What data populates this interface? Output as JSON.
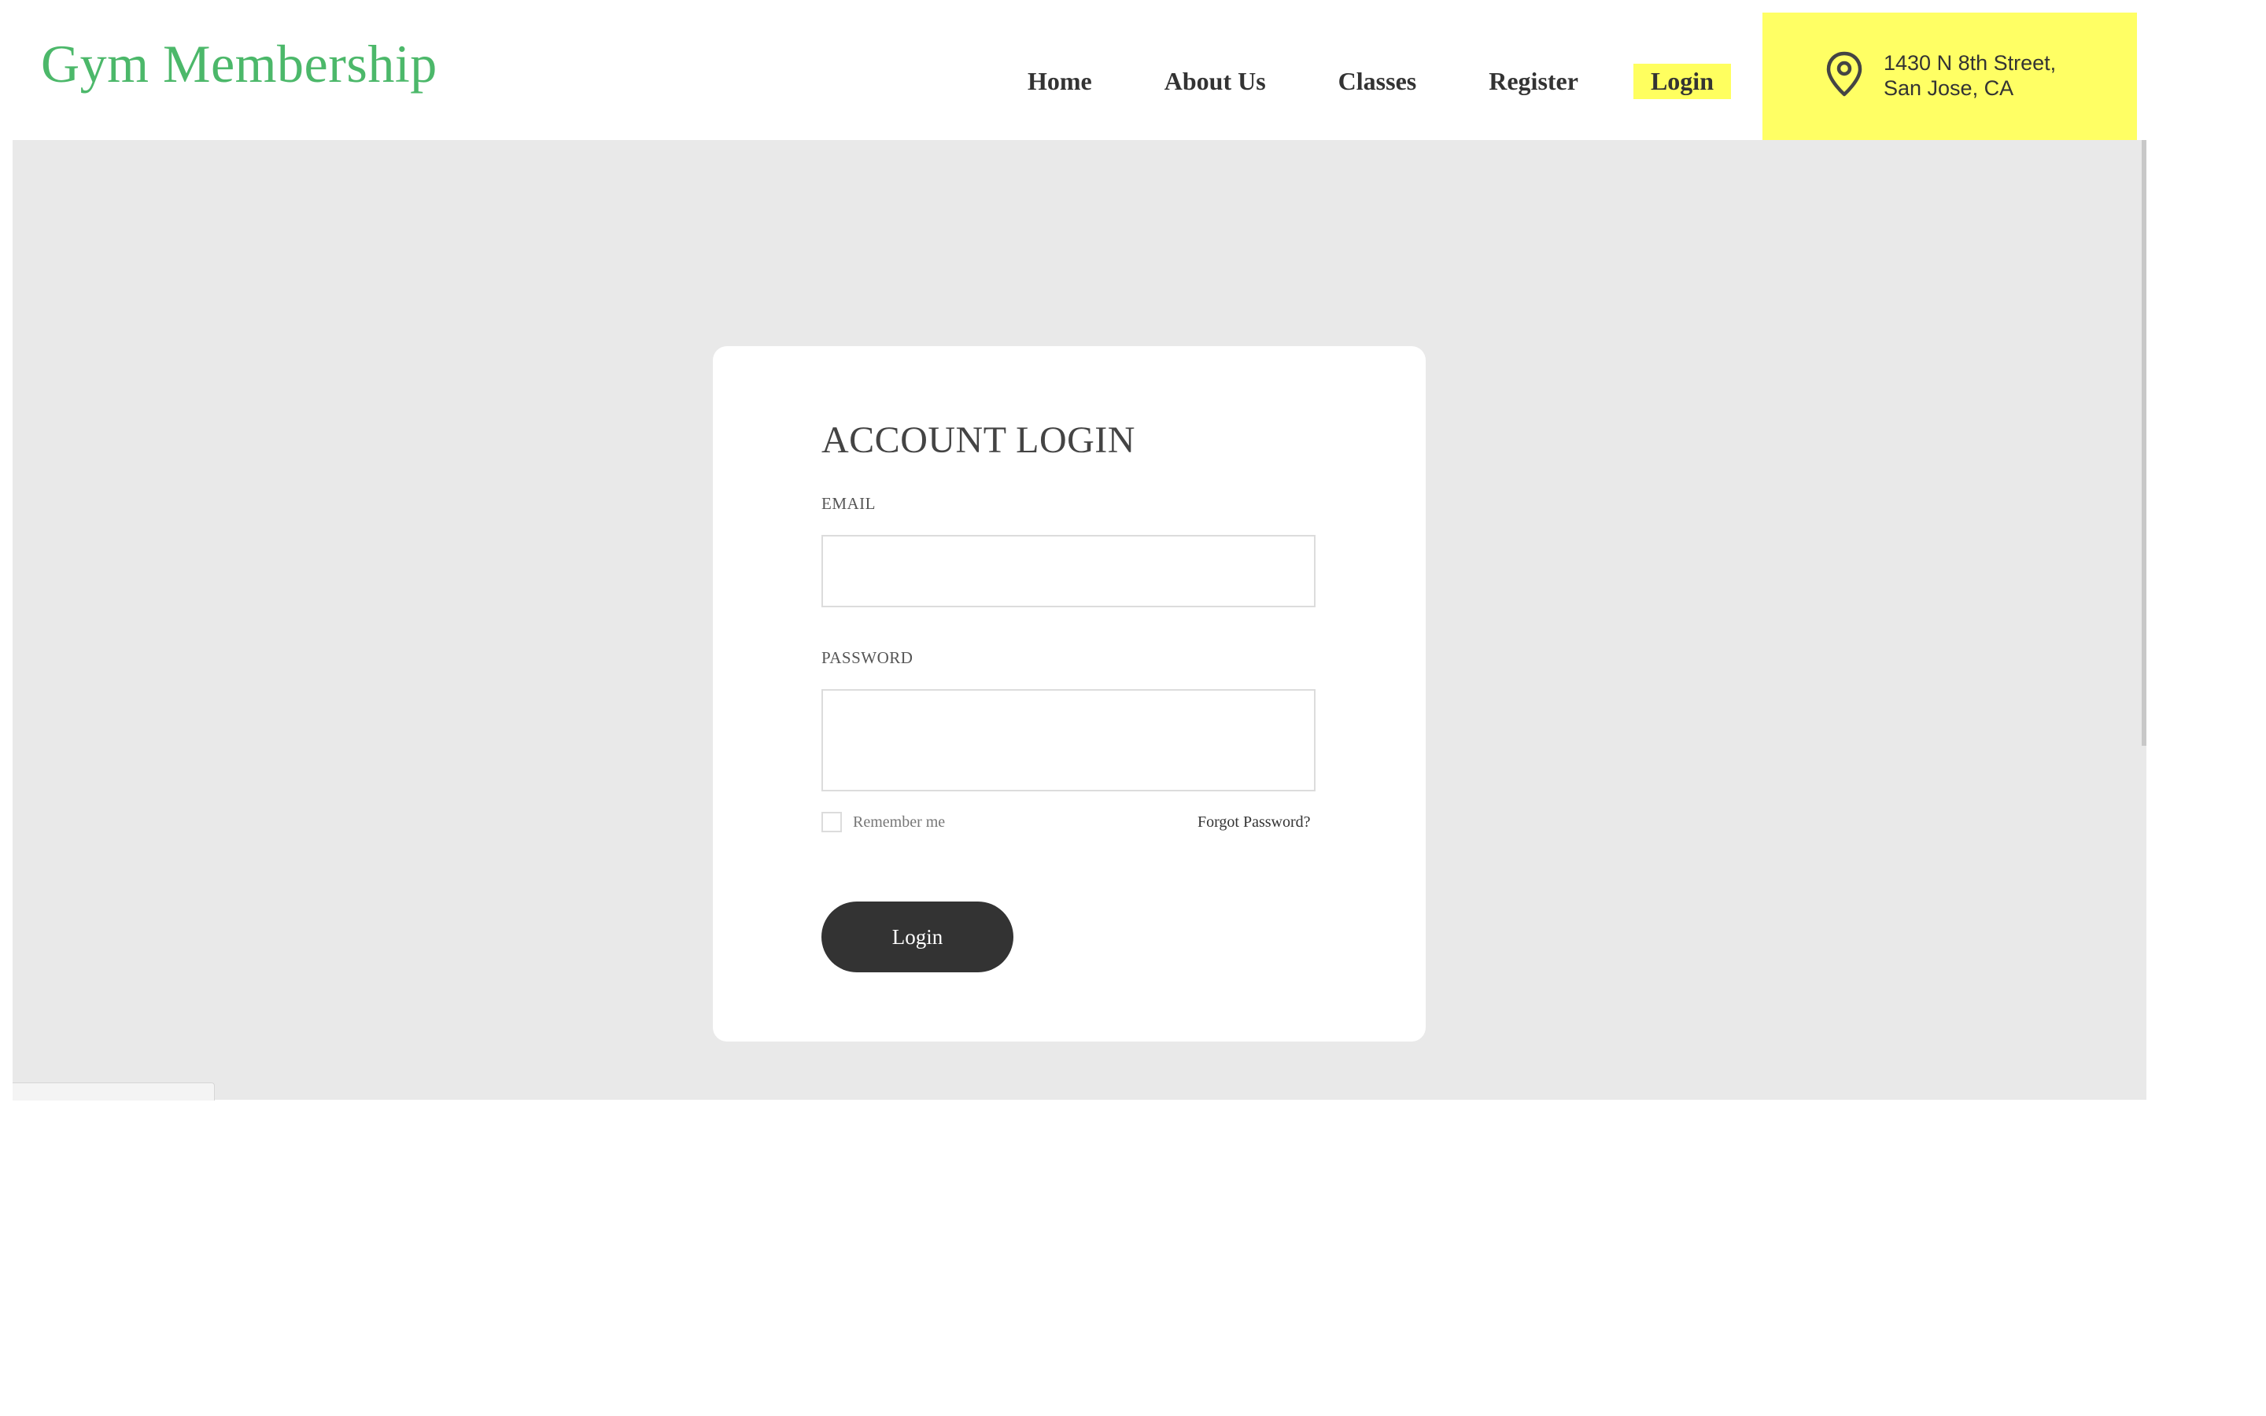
{
  "header": {
    "logo": "Gym Membership",
    "nav": [
      {
        "label": "Home",
        "active": false
      },
      {
        "label": "About Us",
        "active": false
      },
      {
        "label": "Classes",
        "active": false
      },
      {
        "label": "Register",
        "active": false
      },
      {
        "label": "Login",
        "active": true
      }
    ],
    "address": {
      "icon": "map-pin-icon",
      "line1": "1430 N 8th Street,",
      "line2": "San Jose, CA"
    }
  },
  "login_form": {
    "title": "ACCOUNT LOGIN",
    "email_label": "EMAIL",
    "email_value": "",
    "password_label": "PASSWORD",
    "password_value": "",
    "remember_label": "Remember me",
    "remember_checked": false,
    "forgot_label": "Forgot Password?",
    "submit_label": "Login"
  },
  "colors": {
    "logo": "#4cb86a",
    "accent": "#ffff64",
    "button": "#333333",
    "page_background": "#e9e9e9"
  }
}
